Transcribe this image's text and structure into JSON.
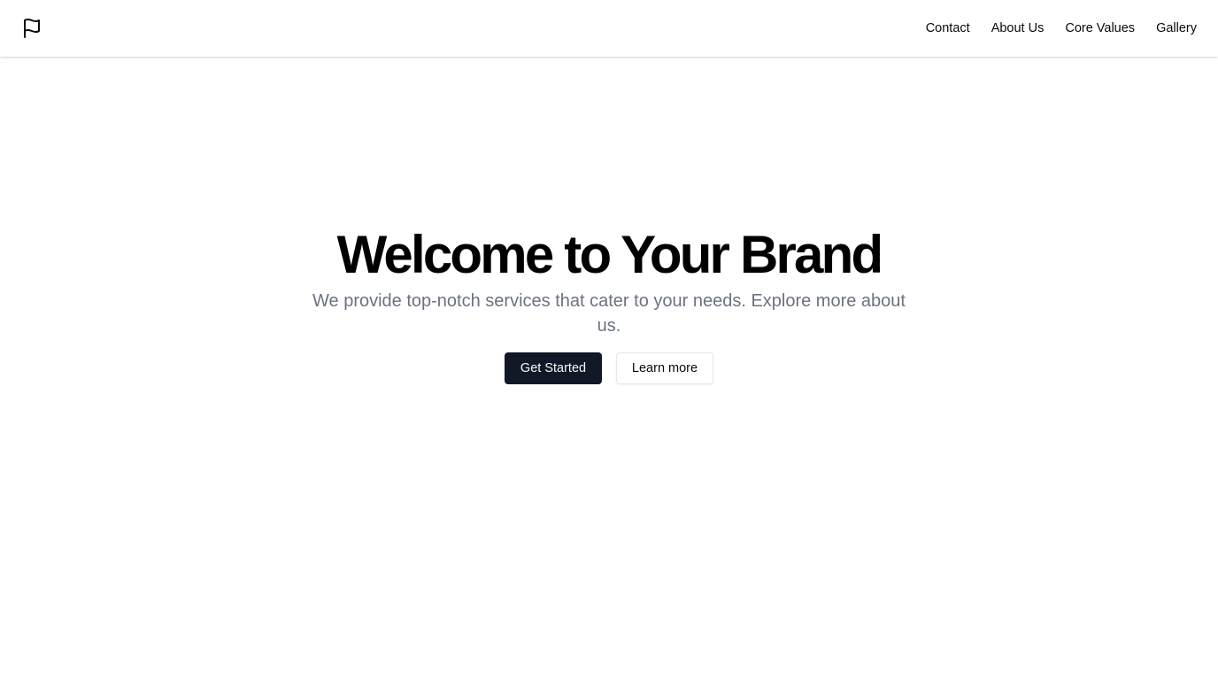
{
  "header": {
    "logo_icon": "flag-icon",
    "nav": [
      {
        "label": "Contact"
      },
      {
        "label": "About Us"
      },
      {
        "label": "Core Values"
      },
      {
        "label": "Gallery"
      }
    ]
  },
  "hero": {
    "title": "Welcome to Your Brand",
    "subtitle": "We provide top-notch services that cater to your needs. Explore more about us.",
    "primary_button": "Get Started",
    "secondary_button": "Learn more"
  },
  "colors": {
    "primary_button_bg": "#111827",
    "subtitle_text": "#6b7280",
    "background": "#ffffff"
  }
}
